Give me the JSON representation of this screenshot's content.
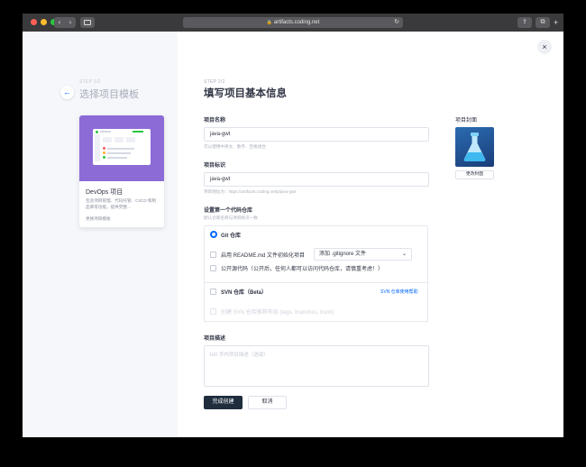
{
  "browser": {
    "address": "artifacts.coding.net",
    "nav_back": "‹",
    "nav_forward": "›",
    "reload": "↻",
    "share": "⇪",
    "tabs": "⧉",
    "new_tab": "+",
    "lock": "🔒"
  },
  "left": {
    "step_label": "STEP 1/2",
    "title": "选择项目模板",
    "back_icon": "←",
    "template": {
      "name": "DevOps 项目",
      "description": "包含项目管理、代码托管、CI/CD 和制品库等功能，提供完整...",
      "change_link": "更换项目模板"
    }
  },
  "main": {
    "close_icon": "×",
    "step_label": "STEP 2/2",
    "title": "填写项目基本信息",
    "project_name": {
      "label": "项目名称",
      "value": "java-gwt",
      "hint": "可以使用中英文、数字、空格组合"
    },
    "project_id": {
      "label": "项目标识",
      "value": "java-gwt",
      "hint": "项目地址为：https://artifacts.coding.net/p/java-gwt"
    },
    "cover": {
      "label": "项目封面",
      "change_button": "更改封面"
    },
    "repo": {
      "label": "设置第一个代码仓库",
      "hint": "默认仓库名称与项目标识一致",
      "git_label": "Git 仓库",
      "readme_label": "启用 README.md 文件初始化项目",
      "gitignore_select": "添加 .gitignore 文件",
      "public_label": "公开源代码（公开后，任何人都可以访问代码仓库，请慎重考虑！）",
      "svn_label": "SVN 仓库（Beta）",
      "svn_help_link": "SVN 仓库使用帮助",
      "svn_layout_label": "创建 SVN 仓库推荐布局 (tags, branches, trunk)"
    },
    "description": {
      "label": "项目描述",
      "placeholder": "100 字内项目描述（选填）"
    },
    "actions": {
      "submit": "完成创建",
      "cancel": "取消"
    }
  },
  "colors": {
    "primary": "#0066ff",
    "dark_button": "#1f2d3d",
    "template_thumb": "#8c6bd6"
  }
}
